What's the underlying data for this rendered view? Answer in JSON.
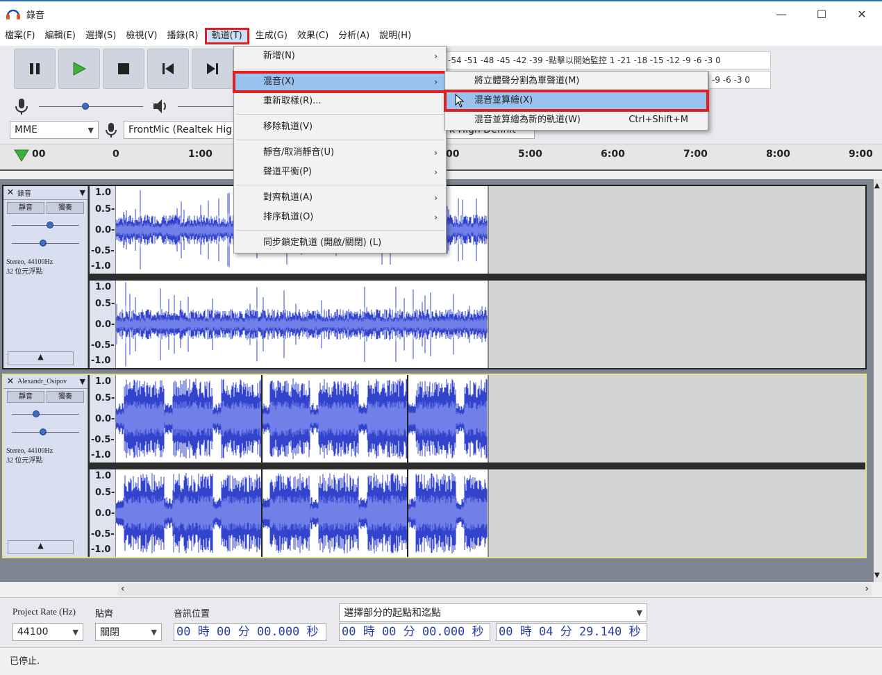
{
  "window": {
    "title": "錄音",
    "app_icon": "headphones-icon"
  },
  "window_controls": {
    "minimize": "—",
    "maximize": "☐",
    "close": "✕"
  },
  "menubar": {
    "items": [
      {
        "label": "檔案(F)"
      },
      {
        "label": "編輯(E)"
      },
      {
        "label": "選擇(S)"
      },
      {
        "label": "檢視(V)"
      },
      {
        "label": "播錄(R)"
      },
      {
        "label": "軌道(T)",
        "active": true
      },
      {
        "label": "生成(G)"
      },
      {
        "label": "效果(C)"
      },
      {
        "label": "分析(A)"
      },
      {
        "label": "說明(H)"
      }
    ]
  },
  "transport": {
    "buttons": [
      "pause-button",
      "play-button",
      "stop-button",
      "skip-start-button",
      "skip-end-button"
    ]
  },
  "meters": {
    "record_scale": "-54 -51 -48 -45 -42 -39 -點擊以開始監控 1 -21 -18 -15 -12 -9 -6 -3 0",
    "play_scale": "-9 -6 -3 0"
  },
  "devices": {
    "host": "MME",
    "input": "FrontMic (Realtek Hig",
    "output_partial": "k High Definit"
  },
  "ruler": {
    "labels": [
      "00",
      "0",
      "1:00",
      "00",
      "5:00",
      "6:00",
      "7:00",
      "8:00",
      "9:00"
    ]
  },
  "tracks": [
    {
      "name": "錄音",
      "mute_label": "靜音",
      "solo_label": "獨奏",
      "info_line1": "Stereo, 44100Hz",
      "info_line2": "32 位元浮點",
      "scale": [
        "1.0",
        "0.5-",
        "0.0-",
        "-0.5-",
        "-1.0"
      ],
      "selected": false
    },
    {
      "name": "Alexandr_Osipov",
      "mute_label": "靜音",
      "solo_label": "獨奏",
      "info_line1": "Stereo, 44100Hz",
      "info_line2": "32 位元浮點",
      "scale": [
        "1.0",
        "0.5-",
        "0.0-",
        "-0.5-",
        "-1.0"
      ],
      "selected": true
    }
  ],
  "bottom": {
    "project_rate_label": "Project Rate (Hz)",
    "project_rate_value": "44100",
    "snap_label": "貼齊",
    "snap_value": "關閉",
    "audio_position_label": "音訊位置",
    "audio_position_value": "00 時 00 分 00.000 秒",
    "selection_mode": "選擇部分的起點和迄點",
    "selection_start": "00 時 00 分 00.000 秒",
    "selection_end": "00 時 04 分 29.140 秒"
  },
  "status": {
    "text": "已停止."
  },
  "tracks_menu": {
    "items": [
      {
        "label": "新增(N)",
        "submenu": true
      },
      {
        "sep": true
      },
      {
        "label": "混音(X)",
        "submenu": true,
        "highlight": true,
        "boxed": true
      },
      {
        "label": "重新取樣(R)..."
      },
      {
        "sep": true
      },
      {
        "label": "移除軌道(V)"
      },
      {
        "sep": true
      },
      {
        "label": "靜音/取消靜音(U)",
        "submenu": true
      },
      {
        "label": "聲道平衡(P)",
        "submenu": true
      },
      {
        "sep": true
      },
      {
        "label": "對齊軌道(A)",
        "submenu": true
      },
      {
        "label": "排序軌道(O)",
        "submenu": true
      },
      {
        "sep": true
      },
      {
        "label": "同步鎖定軌道 (開啟/關閉) (L)"
      }
    ]
  },
  "mix_submenu": {
    "items": [
      {
        "label": "將立體聲分割為單聲道(M)"
      },
      {
        "label": "混音並算繪(X)",
        "highlight": true,
        "boxed": true
      },
      {
        "label": "混音並算繪為新的軌道(W)",
        "shortcut": "Ctrl+Shift+M"
      }
    ]
  },
  "colors": {
    "waveform": "#3344cc",
    "waveform_rms": "#7080e8",
    "highlight_box": "#e02020",
    "menu_highlight": "#99c2ee"
  }
}
